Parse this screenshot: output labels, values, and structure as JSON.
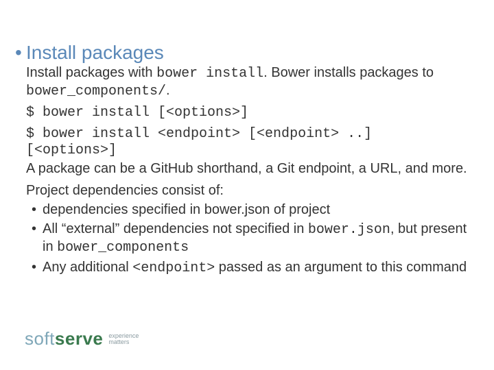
{
  "heading": "Install packages",
  "intro": {
    "pre": "Install packages with ",
    "code1": "bower install",
    "mid": ". Bower installs packages to ",
    "code2": "bower_components/",
    "post": "."
  },
  "cmd1": "$ bower install [<options>]",
  "cmd2": "$ bower install <endpoint> [<endpoint> ..] [<options>]",
  "desc1": "A package can be a GitHub shorthand, a Git endpoint, a URL, and more.",
  "desc2": "Project dependencies consist of:",
  "deps": {
    "d0": "dependencies specified in bower.json of project",
    "d1": {
      "a": "All “external” dependencies not specified in ",
      "b": "bower.json",
      "c": ", but present in ",
      "d": "bower_components"
    },
    "d2": {
      "a": "Any additional ",
      "b": "<endpoint>",
      "c": " passed as an argument to this command"
    }
  },
  "logo": {
    "soft": "soft",
    "serve": "serve",
    "tag1": "experience",
    "tag2": "matters"
  }
}
